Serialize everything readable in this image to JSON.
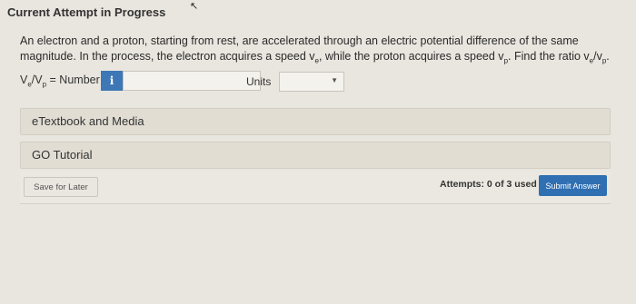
{
  "header": {
    "title": "Current Attempt in Progress"
  },
  "question": {
    "line1_before_ve": "An electron and a proton, starting from rest, are accelerated through an electric potential difference of the same magnitude. In the process, the electron acquires a speed v",
    "ve_sub": "e",
    "line_middle": ", while the proton acquires a speed v",
    "vp_sub": "p",
    "line_end": ". Find the ratio v",
    "ratio_sub1": "e",
    "ratio_slash": "/v",
    "ratio_sub2": "p",
    "line_period": "."
  },
  "answer": {
    "label_v1": "V",
    "label_sub1": "e",
    "label_slash": "/V",
    "label_sub2": "p",
    "label_rest": " = Number",
    "info_icon_text": "i",
    "number_value": "",
    "units_label": "Units",
    "units_value": ""
  },
  "panels": {
    "etextbook": "eTextbook and Media",
    "go_tutorial": "GO Tutorial"
  },
  "footer": {
    "save_label": "Save for Later",
    "attempts_text": "Attempts: 0 of 3 used",
    "submit_label": "Submit Answer"
  },
  "colors": {
    "accent": "#2f6fb2",
    "info_button": "#3d77b5",
    "background": "#e9e6df"
  }
}
